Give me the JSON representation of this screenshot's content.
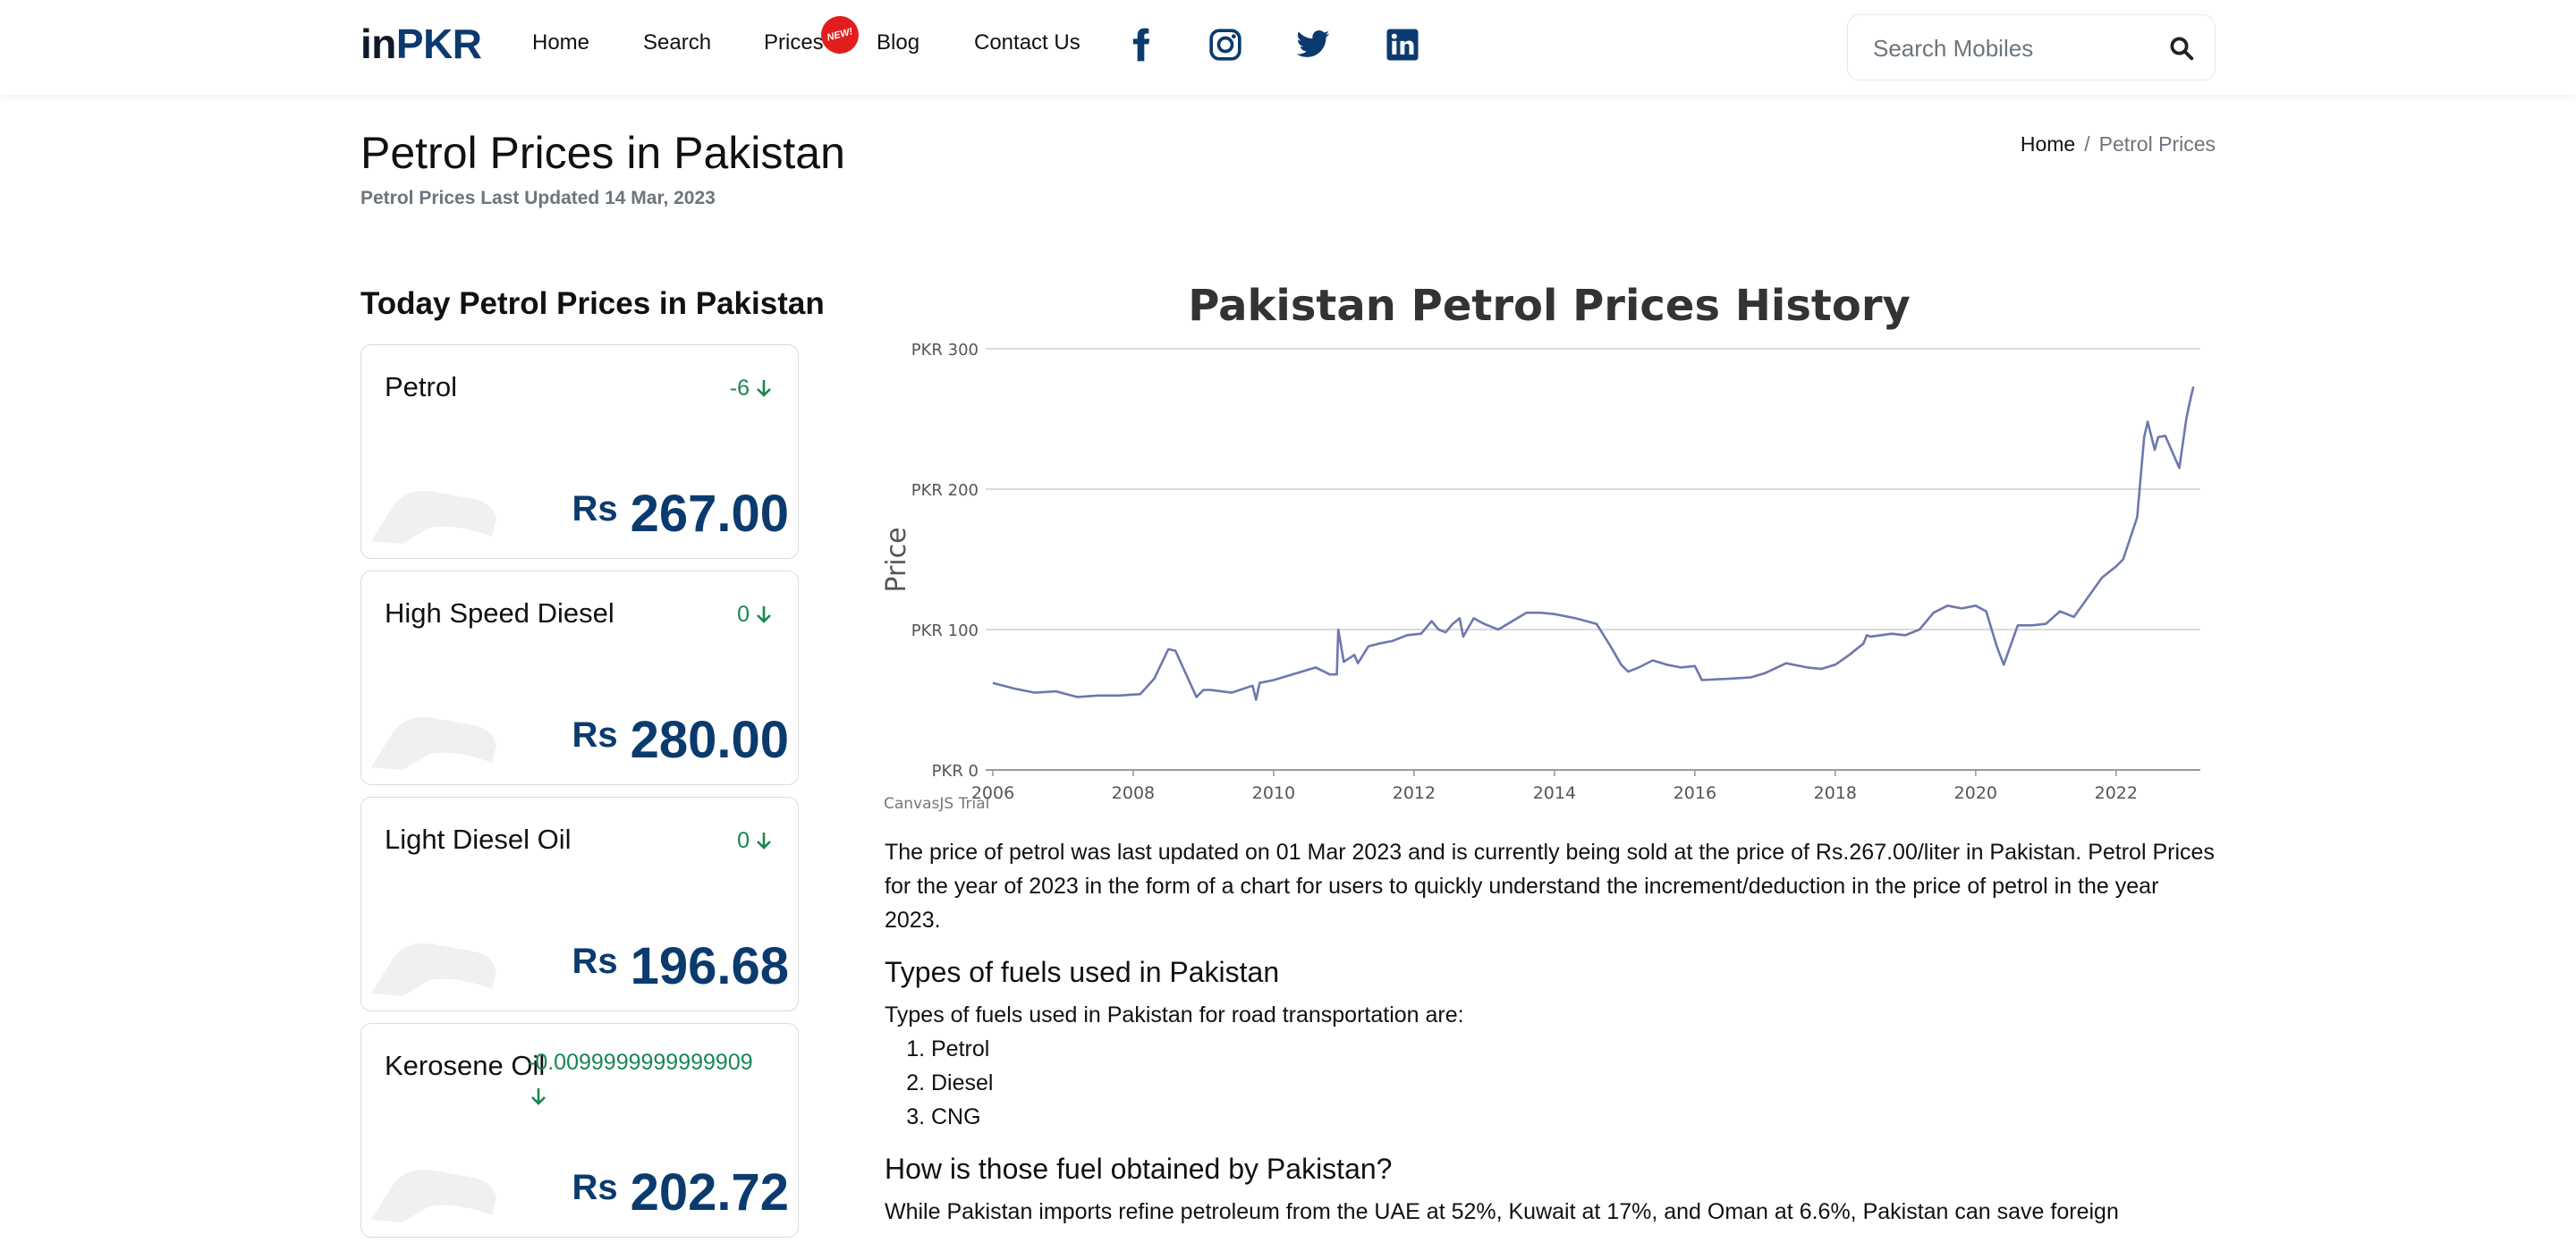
{
  "brand": {
    "prefix": "in",
    "suffix": "PKR"
  },
  "nav": {
    "links": [
      "Home",
      "Search",
      "Prices",
      "Blog",
      "Contact Us"
    ],
    "new_badge": "NEW!",
    "social": [
      "facebook-icon",
      "instagram-icon",
      "twitter-icon",
      "linkedin-icon"
    ]
  },
  "search": {
    "placeholder": "Search Mobiles"
  },
  "header": {
    "title": "Petrol Prices in Pakistan",
    "updated": "Petrol Prices Last Updated 14 Mar, 2023",
    "breadcrumb": {
      "home": "Home",
      "separator": "/",
      "current": "Petrol Prices"
    }
  },
  "today": {
    "title": "Today Petrol Prices in Pakistan",
    "currency": "Rs",
    "cards": [
      {
        "name": "Petrol",
        "change": "-6",
        "price": "267.00"
      },
      {
        "name": "High Speed Diesel",
        "change": "0",
        "price": "280.00"
      },
      {
        "name": "Light Diesel Oil",
        "change": "0",
        "price": "196.68"
      },
      {
        "name": "Kerosene Oil",
        "change": "-0.0099999999999909",
        "price": "202.72"
      }
    ]
  },
  "colors": {
    "brand": "#0b3b6e",
    "positive": "#198754",
    "line": "#6d78ad",
    "badge": "#e21d1d"
  },
  "chart_data": {
    "type": "line",
    "title": "Pakistan Petrol Prices History",
    "ylabel": "Price",
    "xlabel": "",
    "watermark": "CanvasJS Trial",
    "xlim": [
      2006,
      2023.2
    ],
    "ylim": [
      0,
      300
    ],
    "yticks": [
      "PKR 0",
      "PKR 100",
      "PKR 200",
      "PKR 300"
    ],
    "xticks": [
      "2006",
      "2008",
      "2010",
      "2012",
      "2014",
      "2016",
      "2018",
      "2020",
      "2022"
    ],
    "grid": true,
    "series": [
      {
        "x": [
          2006.0,
          2006.3,
          2006.6,
          2006.9,
          2007.2,
          2007.5,
          2007.8,
          2008.1,
          2008.3,
          2008.5,
          2008.6,
          2008.9,
          2009.0,
          2009.1,
          2009.4,
          2009.7,
          2009.75,
          2009.8,
          2010.0,
          2010.2,
          2010.4,
          2010.6,
          2010.8,
          2010.9,
          2010.92,
          2011.0,
          2011.15,
          2011.2,
          2011.35,
          2011.5,
          2011.7,
          2011.9,
          2012.1,
          2012.25,
          2012.35,
          2012.45,
          2012.55,
          2012.65,
          2012.7,
          2012.85,
          2013.0,
          2013.2,
          2013.4,
          2013.6,
          2013.8,
          2014.0,
          2014.3,
          2014.6,
          2014.8,
          2014.95,
          2015.05,
          2015.2,
          2015.4,
          2015.6,
          2015.8,
          2016.0,
          2016.1,
          2016.5,
          2016.8,
          2017.0,
          2017.3,
          2017.6,
          2017.8,
          2018.0,
          2018.2,
          2018.4,
          2018.45,
          2018.5,
          2018.8,
          2019.0,
          2019.2,
          2019.4,
          2019.6,
          2019.8,
          2020.0,
          2020.15,
          2020.3,
          2020.4,
          2020.6,
          2020.8,
          2021.0,
          2021.2,
          2021.4,
          2021.6,
          2021.8,
          2022.0,
          2022.1,
          2022.3,
          2022.4,
          2022.45,
          2022.55,
          2022.6,
          2022.7,
          2022.9,
          2023.0,
          2023.05,
          2023.1
        ],
        "y": [
          62,
          58,
          55,
          56,
          52,
          53,
          53,
          54,
          65,
          86,
          85,
          52,
          57,
          57,
          55,
          60,
          50,
          62,
          64,
          67,
          70,
          73,
          68,
          68,
          100,
          77,
          82,
          76,
          88,
          90,
          92,
          96,
          97,
          106,
          100,
          98,
          104,
          108,
          95,
          108,
          104,
          100,
          106,
          112,
          112,
          111,
          108,
          104,
          88,
          75,
          70,
          73,
          78,
          75,
          73,
          74,
          64,
          65,
          66,
          69,
          76,
          73,
          72,
          75,
          82,
          90,
          96,
          95,
          97,
          96,
          100,
          112,
          117,
          115,
          117,
          113,
          88,
          75,
          103,
          103,
          104,
          113,
          109,
          123,
          137,
          145,
          150,
          180,
          237,
          248,
          228,
          237,
          238,
          215,
          250,
          262,
          273
        ]
      }
    ]
  },
  "article": {
    "intro": "The price of petrol was last updated on 01 Mar 2023 and is currently being sold at the price of Rs.267.00/liter in Pakistan. Petrol Prices for the year of 2023 in the form of a chart for users to quickly understand the increment/deduction in the price of petrol in the year 2023.",
    "types_heading": "Types of fuels used in Pakistan",
    "types_intro": "Types of fuels used in Pakistan for road transportation are:",
    "types": [
      "Petrol",
      "Diesel",
      "CNG"
    ],
    "obtain_heading": "How is those fuel obtained by Pakistan?",
    "obtain_text": "While Pakistan imports refine petroleum from the UAE at 52%, Kuwait at 17%, and Oman at 6.6%, Pakistan can save foreign"
  }
}
